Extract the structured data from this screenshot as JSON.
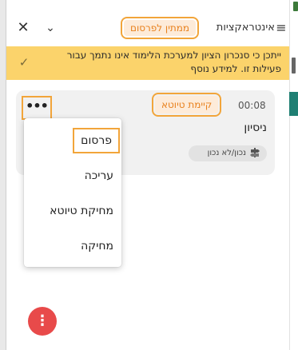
{
  "header": {
    "title": "אינטראקציות",
    "status_badge": "ממתין לפרסום",
    "close_icon": "✕",
    "chevron_icon": "⌄",
    "menu_icon": "≡"
  },
  "alert": {
    "text": "ייתכן כי סנכרון הציון למערכת הלימוד אינו נתמך עבור פעילות זו. למידע נוסף",
    "check_icon": "✓",
    "background": "#fbd36b"
  },
  "card": {
    "time": "00:08",
    "draft_badge": "קיימת טיוטא",
    "title": "ניסיון",
    "type_label": "נכון/לא נכון",
    "type_icon": "signpost-icon",
    "more_label": "•••"
  },
  "menu": {
    "items": [
      "פרסום",
      "עריכה",
      "מחיקת טיוטא",
      "מחיקה"
    ]
  },
  "fab": {
    "label": "⋮",
    "color": "#e84a4a"
  },
  "colors": {
    "accent_orange": "#e8811e",
    "highlight_outline": "#f2a53a",
    "badge_bg": "#fdebd9",
    "sidebar_teal": "#1f7f73"
  }
}
